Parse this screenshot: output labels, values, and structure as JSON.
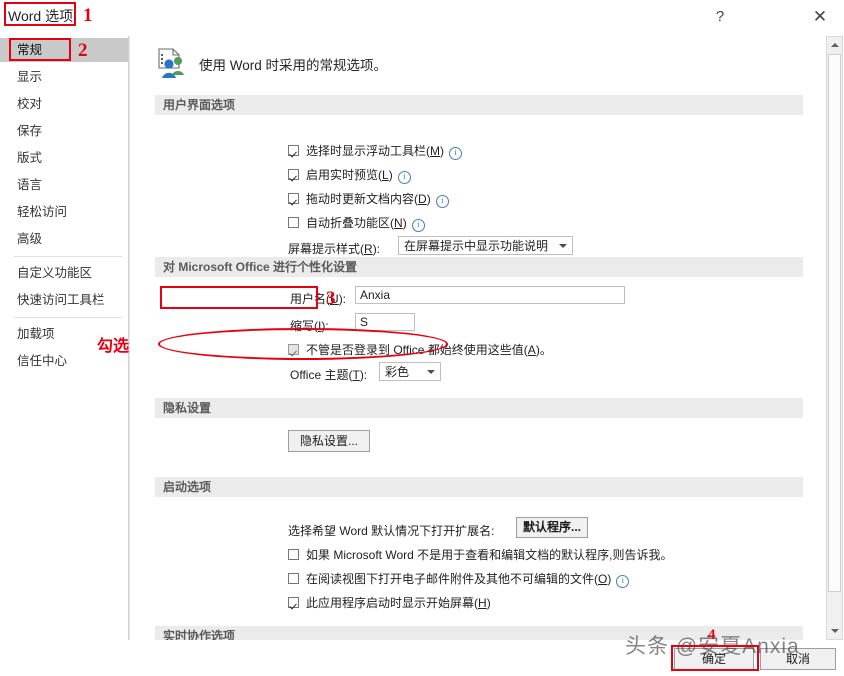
{
  "window": {
    "title": "Word 选项",
    "help_icon": "?",
    "close_icon": "✕"
  },
  "sidebar": {
    "items": [
      {
        "label": "常规",
        "active": true
      },
      {
        "label": "显示",
        "active": false
      },
      {
        "label": "校对",
        "active": false
      },
      {
        "label": "保存",
        "active": false
      },
      {
        "label": "版式",
        "active": false
      },
      {
        "label": "语言",
        "active": false
      },
      {
        "label": "轻松访问",
        "active": false
      },
      {
        "label": "高级",
        "active": false
      },
      {
        "label": "自定义功能区",
        "active": false
      },
      {
        "label": "快速访问工具栏",
        "active": false
      },
      {
        "label": "加载项",
        "active": false
      },
      {
        "label": "信任中心",
        "active": false
      }
    ]
  },
  "content": {
    "intro_text": "使用 Word 时采用的常规选项。",
    "intro_icon": "document-people-icon",
    "sections": {
      "ui_options": {
        "title": "用户界面选项",
        "checkboxes": [
          {
            "label": "选择时显示浮动工具栏",
            "accel": "M",
            "checked": true,
            "info": true
          },
          {
            "label": "启用实时预览",
            "accel": "L",
            "checked": true,
            "info": true
          },
          {
            "label": "拖动时更新文档内容",
            "accel": "D",
            "checked": true,
            "info": true
          },
          {
            "label": "自动折叠功能区",
            "accel": "N",
            "checked": false,
            "info": true
          }
        ],
        "screentip": {
          "label": "屏幕提示样式",
          "accel": "R",
          "value": "在屏幕提示中显示功能说明"
        }
      },
      "personalize": {
        "title_pre": "对 ",
        "title_brand": "Microsoft Office",
        "title_post": " 进行个性化设置",
        "username": {
          "label": "用户名",
          "accel": "U",
          "value": "Anxia"
        },
        "initials": {
          "label": "缩写",
          "accel": "I",
          "value": "S"
        },
        "always_use": {
          "label": "不管是否登录到 Office 都始终使用这些值",
          "accel": "A",
          "suffix": "。",
          "checked": true,
          "disabled": true
        },
        "theme": {
          "label": "Office 主题",
          "accel": "T",
          "value": "彩色"
        }
      },
      "privacy": {
        "title": "隐私设置",
        "button": "隐私设置..."
      },
      "startup": {
        "title": "启动选项",
        "default_prog_label": "选择希望 Word 默认情况下打开扩展名:",
        "default_prog_button": "默认程序...",
        "checkboxes": [
          {
            "label": "如果 Microsoft Word 不是用于查看和编辑文档的默认程序,则告诉我。",
            "accel": "",
            "checked": false,
            "info": false
          },
          {
            "label": "在阅读视图下打开电子邮件附件及其他不可编辑的文件",
            "accel": "O",
            "checked": false,
            "info": true
          },
          {
            "label": "此应用程序启动时显示开始屏幕",
            "accel": "H",
            "checked": true,
            "info": false
          }
        ]
      },
      "realtime": {
        "title": "实时协作选项"
      }
    }
  },
  "footer": {
    "ok_button": "确定",
    "cancel_button": "取消"
  },
  "annotations": {
    "num1": "1",
    "num2": "2",
    "num3": "3",
    "num4": "4",
    "check_label": "勾选"
  },
  "watermark": {
    "text": "头条 @安夏Anxia"
  },
  "scrollbar": {
    "up_arrow": "scroll-up-arrow",
    "down_arrow": "scroll-down-arrow"
  }
}
